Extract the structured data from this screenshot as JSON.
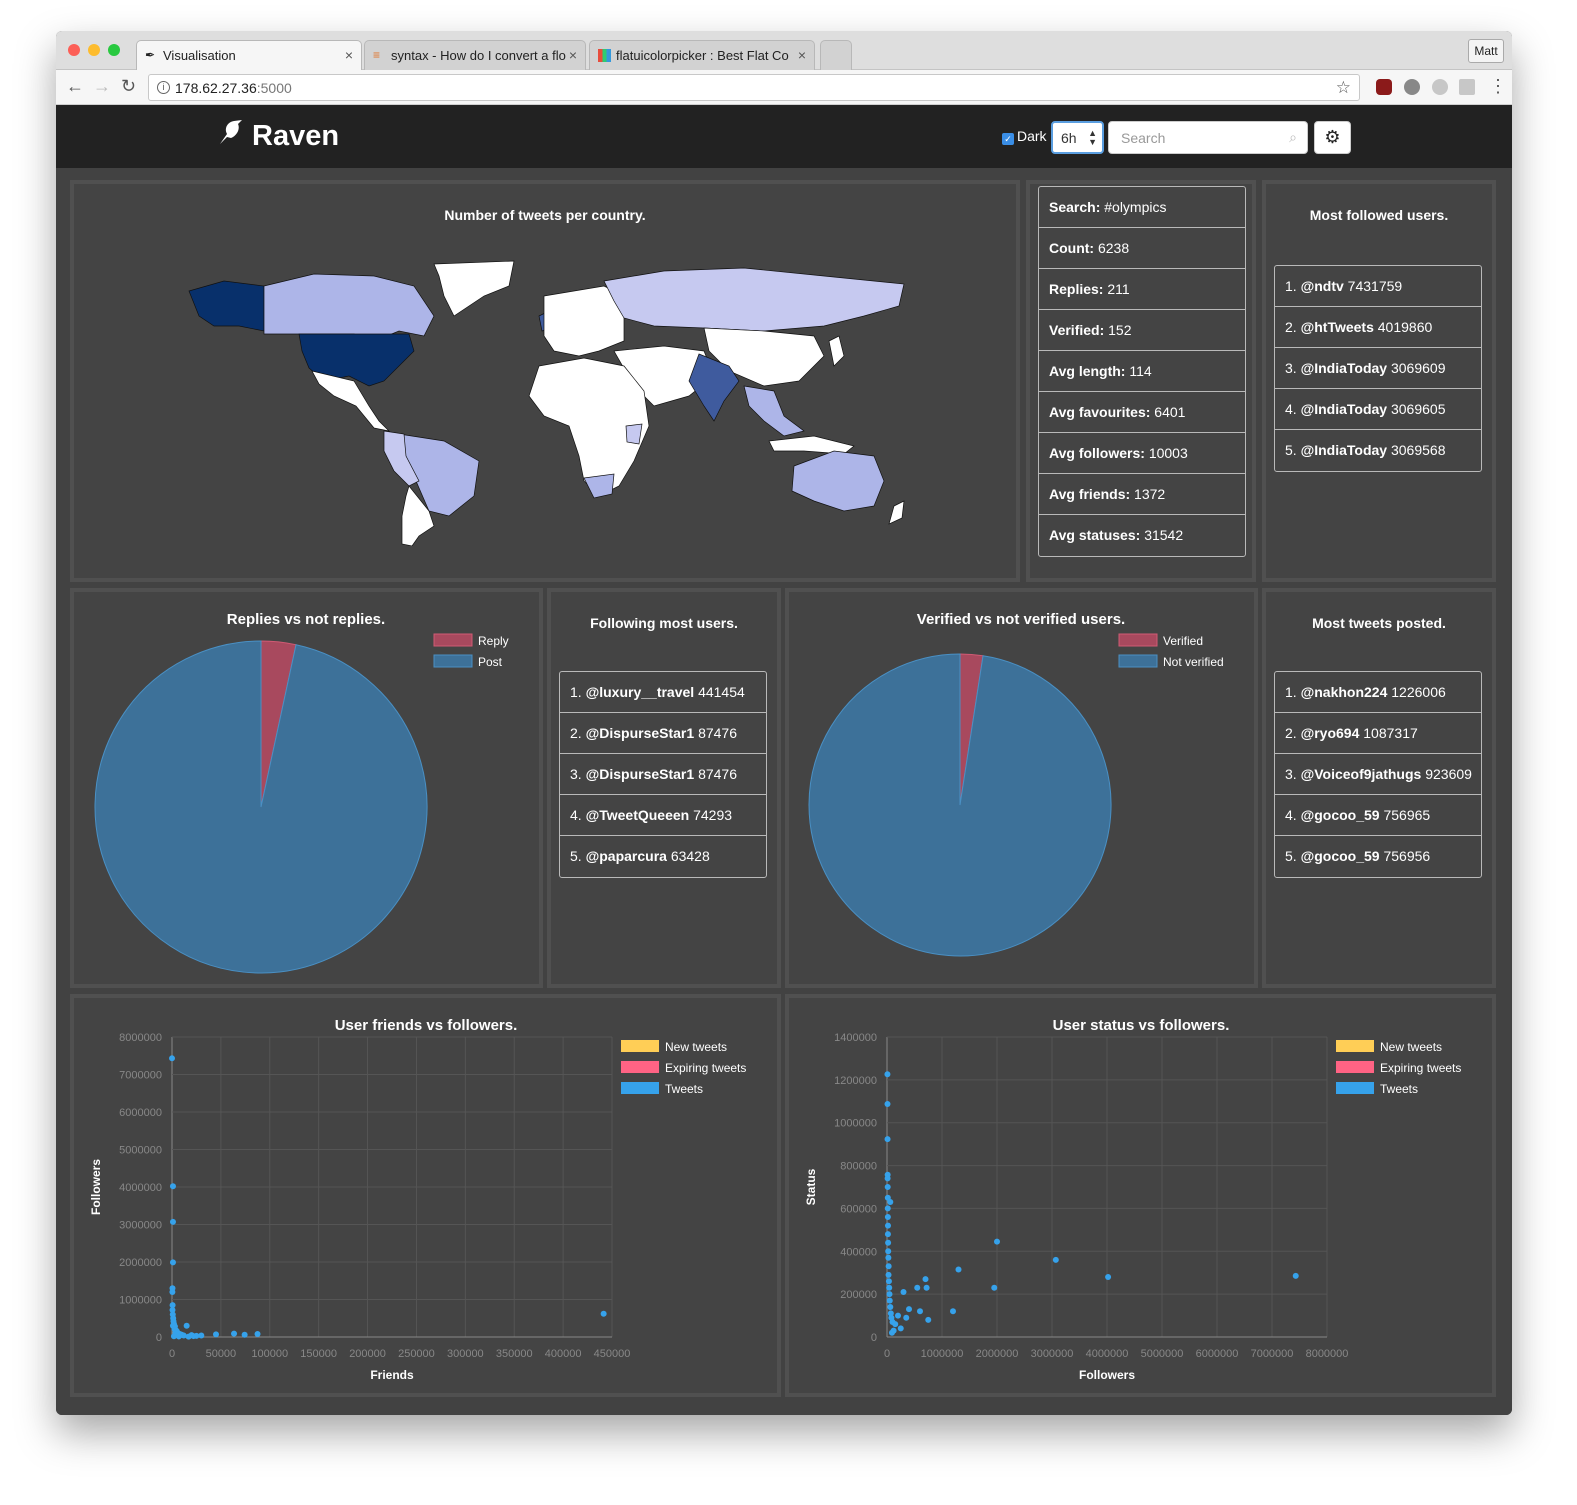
{
  "browser": {
    "tabs": [
      {
        "title": "Visualisation"
      },
      {
        "title": "syntax - How do I convert a flo"
      },
      {
        "title": "flatuicolorpicker : Best Flat Co"
      }
    ],
    "url_host": "178.62.27.36",
    "url_port": ":5000",
    "profile": "Matt"
  },
  "app": {
    "brand": "Raven",
    "dark_label": "Dark",
    "dark_checked": true,
    "time_range": "6h",
    "search_placeholder": "Search"
  },
  "map": {
    "title": "Number of tweets per country."
  },
  "stats": [
    {
      "label": "Search:",
      "value": "#olympics"
    },
    {
      "label": "Count:",
      "value": "6238"
    },
    {
      "label": "Replies:",
      "value": "211"
    },
    {
      "label": "Verified:",
      "value": "152"
    },
    {
      "label": "Avg length:",
      "value": "114"
    },
    {
      "label": "Avg favourites:",
      "value": "6401"
    },
    {
      "label": "Avg followers:",
      "value": "10003"
    },
    {
      "label": "Avg friends:",
      "value": "1372"
    },
    {
      "label": "Avg statuses:",
      "value": "31542"
    }
  ],
  "most_followed": {
    "title": "Most followed users.",
    "items": [
      {
        "rank": "1.",
        "user": "@ndtv",
        "value": "7431759"
      },
      {
        "rank": "2.",
        "user": "@htTweets",
        "value": "4019860"
      },
      {
        "rank": "3.",
        "user": "@IndiaToday",
        "value": "3069609"
      },
      {
        "rank": "4.",
        "user": "@IndiaToday",
        "value": "3069605"
      },
      {
        "rank": "5.",
        "user": "@IndiaToday",
        "value": "3069568"
      }
    ]
  },
  "following_most": {
    "title": "Following most users.",
    "items": [
      {
        "rank": "1.",
        "user": "@luxury__travel",
        "value": "441454"
      },
      {
        "rank": "2.",
        "user": "@DispurseStar1",
        "value": "87476"
      },
      {
        "rank": "3.",
        "user": "@DispurseStar1",
        "value": "87476"
      },
      {
        "rank": "4.",
        "user": "@TweetQueeen",
        "value": "74293"
      },
      {
        "rank": "5.",
        "user": "@paparcura",
        "value": "63428"
      }
    ]
  },
  "most_tweets": {
    "title": "Most tweets posted.",
    "items": [
      {
        "rank": "1.",
        "user": "@nakhon224",
        "value": "1226006"
      },
      {
        "rank": "2.",
        "user": "@ryo694",
        "value": "1087317"
      },
      {
        "rank": "3.",
        "user": "@Voiceof9jathugs",
        "value": "923609"
      },
      {
        "rank": "4.",
        "user": "@gocoo_59",
        "value": "756965"
      },
      {
        "rank": "5.",
        "user": "@gocoo_59",
        "value": "756956"
      }
    ]
  },
  "colors": {
    "reply": "#a8495e",
    "post": "#3d7199",
    "dot": "#36a2eb",
    "new_tweets": "#ffce56",
    "expiring_tweets": "#ff6384"
  },
  "chart_data": [
    {
      "type": "pie",
      "title": "Replies vs not replies.",
      "labels": [
        "Reply",
        "Post"
      ],
      "values": [
        211,
        6027
      ]
    },
    {
      "type": "pie",
      "title": "Verified vs not verified users.",
      "labels": [
        "Verified",
        "Not verified"
      ],
      "values": [
        152,
        6086
      ]
    },
    {
      "type": "scatter",
      "title": "User friends vs followers.",
      "xlabel": "Friends",
      "ylabel": "Followers",
      "xlim": [
        0,
        450000
      ],
      "ylim": [
        0,
        8000000
      ],
      "xticks": [
        "0",
        "50000",
        "100000",
        "150000",
        "200000",
        "250000",
        "300000",
        "350000",
        "400000",
        "450000"
      ],
      "yticks": [
        "0",
        "1000000",
        "2000000",
        "3000000",
        "4000000",
        "5000000",
        "6000000",
        "7000000",
        "8000000"
      ],
      "legend": [
        "New tweets",
        "Expiring tweets",
        "Tweets"
      ],
      "series": [
        {
          "name": "Tweets",
          "points": [
            [
              0,
              7431759
            ],
            [
              1000,
              4019860
            ],
            [
              1000,
              3069609
            ],
            [
              1000,
              1990000
            ],
            [
              500,
              1300000
            ],
            [
              400,
              1200000
            ],
            [
              600,
              850000
            ],
            [
              500,
              720000
            ],
            [
              800,
              600000
            ],
            [
              1200,
              500000
            ],
            [
              1500,
              420000
            ],
            [
              2000,
              350000
            ],
            [
              1000,
              300000
            ],
            [
              3000,
              280000
            ],
            [
              2500,
              220000
            ],
            [
              4000,
              180000
            ],
            [
              5000,
              150000
            ],
            [
              3500,
              120000
            ],
            [
              6000,
              100000
            ],
            [
              8000,
              80000
            ],
            [
              10000,
              60000
            ],
            [
              15000,
              300000
            ],
            [
              12000,
              40000
            ],
            [
              20000,
              50000
            ],
            [
              25000,
              30000
            ],
            [
              30000,
              40000
            ],
            [
              45000,
              70000
            ],
            [
              63428,
              90000
            ],
            [
              74293,
              60000
            ],
            [
              87476,
              80000
            ],
            [
              441454,
              620000
            ],
            [
              2000,
              20000
            ],
            [
              7000,
              15000
            ],
            [
              17000,
              10000
            ],
            [
              22000,
              25000
            ]
          ]
        }
      ]
    },
    {
      "type": "scatter",
      "title": "User status vs followers.",
      "xlabel": "Followers",
      "ylabel": "Status",
      "xlim": [
        0,
        8000000
      ],
      "ylim": [
        0,
        1400000
      ],
      "xticks": [
        "0",
        "1000000",
        "2000000",
        "3000000",
        "4000000",
        "5000000",
        "6000000",
        "7000000",
        "8000000"
      ],
      "yticks": [
        "0",
        "200000",
        "400000",
        "600000",
        "800000",
        "1000000",
        "1200000",
        "1400000"
      ],
      "legend": [
        "New tweets",
        "Expiring tweets",
        "Tweets"
      ],
      "series": [
        {
          "name": "Tweets",
          "points": [
            [
              8000,
              1226006
            ],
            [
              9000,
              1087317
            ],
            [
              10000,
              923609
            ],
            [
              12000,
              756965
            ],
            [
              11000,
              740000
            ],
            [
              13000,
              700000
            ],
            [
              15000,
              650000
            ],
            [
              60000,
              630000
            ],
            [
              14000,
              600000
            ],
            [
              16000,
              560000
            ],
            [
              18000,
              520000
            ],
            [
              17000,
              480000
            ],
            [
              20000,
              440000
            ],
            [
              22000,
              400000
            ],
            [
              25000,
              370000
            ],
            [
              30000,
              330000
            ],
            [
              28000,
              290000
            ],
            [
              35000,
              260000
            ],
            [
              40000,
              230000
            ],
            [
              45000,
              200000
            ],
            [
              50000,
              170000
            ],
            [
              60000,
              140000
            ],
            [
              70000,
              110000
            ],
            [
              80000,
              90000
            ],
            [
              100000,
              70000
            ],
            [
              150000,
              60000
            ],
            [
              200000,
              100000
            ],
            [
              300000,
              210000
            ],
            [
              350000,
              90000
            ],
            [
              550000,
              230000
            ],
            [
              600000,
              120000
            ],
            [
              700000,
              270000
            ],
            [
              720000,
              230000
            ],
            [
              750000,
              80000
            ],
            [
              1200000,
              120000
            ],
            [
              1300000,
              315000
            ],
            [
              1950000,
              230000
            ],
            [
              2000000,
              445000
            ],
            [
              3069609,
              360000
            ],
            [
              4019860,
              280000
            ],
            [
              7431759,
              285000
            ],
            [
              250000,
              40000
            ],
            [
              400000,
              130000
            ],
            [
              120000,
              30000
            ],
            [
              90000,
              20000
            ]
          ]
        }
      ]
    }
  ]
}
